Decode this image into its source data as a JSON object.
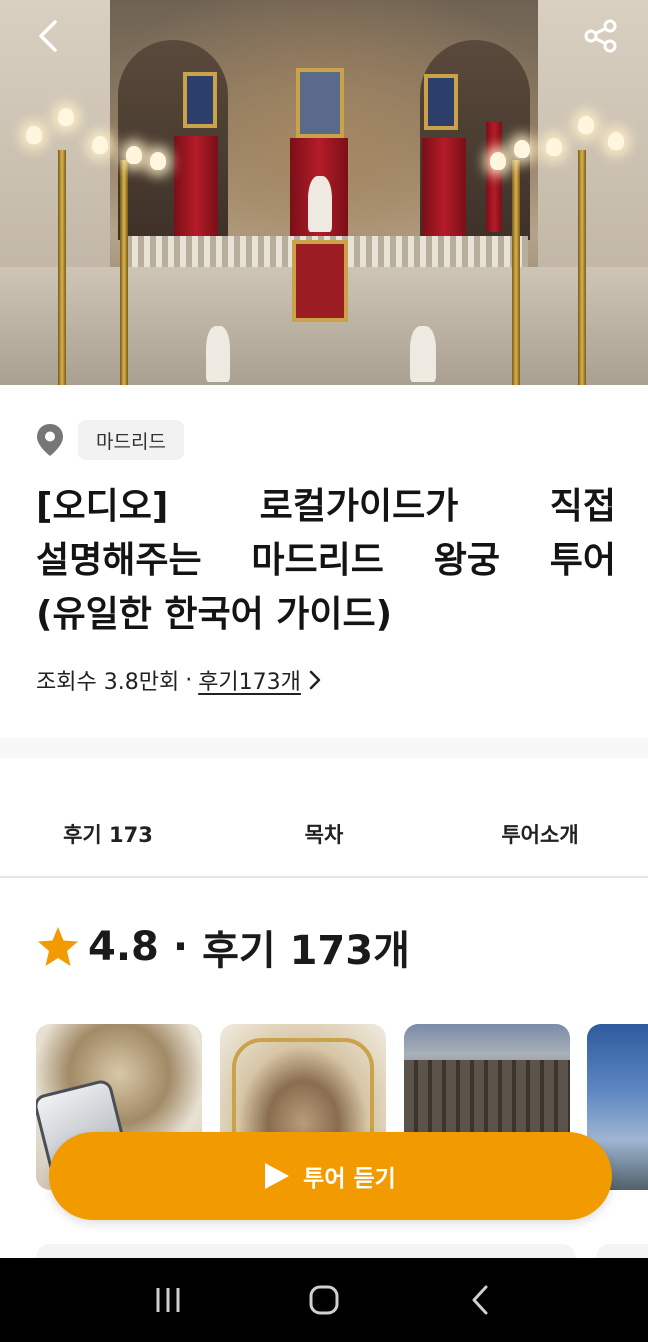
{
  "location": {
    "label": "마드리드"
  },
  "title": "[오디오] 로컬가이드가 직접 설명해주는 마드리드 왕궁 투어 (유일한 한국어 가이드)",
  "meta": {
    "views": "조회수 3.8만회",
    "separator": "·",
    "reviews_link": "후기173개"
  },
  "tabs": [
    {
      "label": "후기 173"
    },
    {
      "label": "목차"
    },
    {
      "label": "투어소개"
    }
  ],
  "rating": {
    "score": "4.8",
    "separator": "·",
    "reviews": "후기 173개",
    "star_color": "#F29B00"
  },
  "play_button": {
    "label": "투어 듣기",
    "color": "#F29B00"
  },
  "icons": {
    "back": "chevron-left-icon",
    "share": "share-icon",
    "location": "map-pin-icon",
    "star": "star-icon",
    "play": "play-icon",
    "nav_recents": "recents-icon",
    "nav_home": "home-icon",
    "nav_back": "back-icon"
  }
}
